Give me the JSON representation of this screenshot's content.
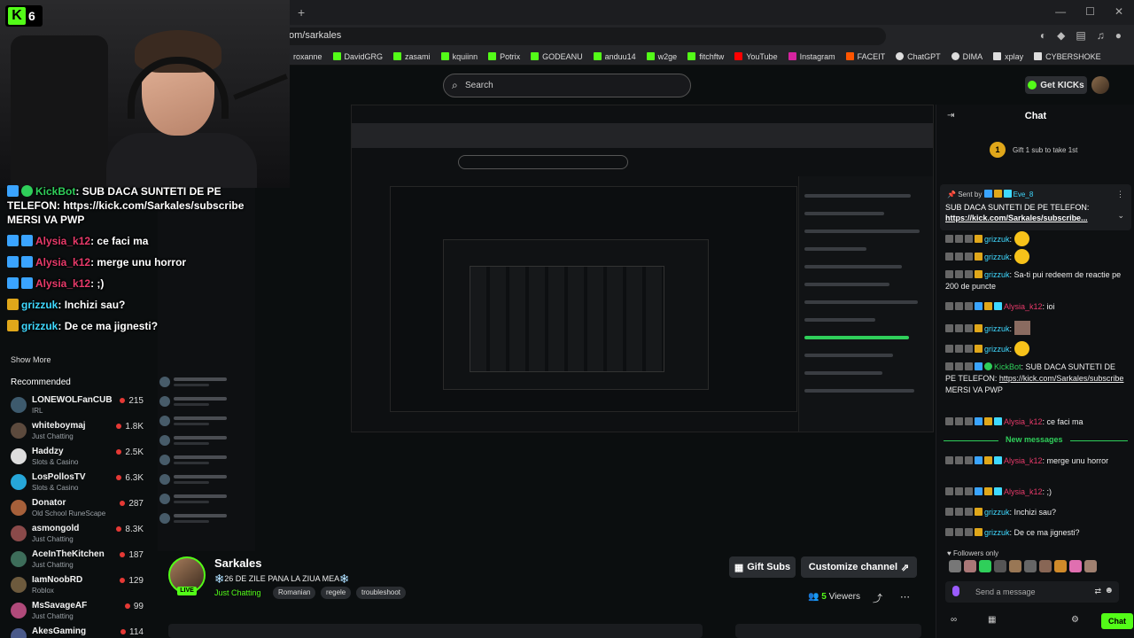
{
  "browser": {
    "url": "om/sarkales",
    "bookmarks": [
      "roxanne",
      "DavidGRG",
      "zasami",
      "kquiinn",
      "Potrix",
      "GODEANU",
      "anduu14",
      "w2ge",
      "fitchftw",
      "YouTube",
      "Instagram",
      "FACEIT",
      "ChatGPT",
      "DIMA",
      "xplay",
      "CYBERSHOKE"
    ]
  },
  "header": {
    "search_placeholder": "Search",
    "get_kicks": "Get KICKs"
  },
  "overlay": {
    "badge_count": "6",
    "chat": [
      {
        "user": "KickBot",
        "text": "SUB DACA SUNTETI DE PE"
      },
      {
        "user": "",
        "text": "TELEFON: https://kick.com/Sarkales/subscribe"
      },
      {
        "user": "",
        "text": "MERSI VA PWP"
      },
      {
        "user": "Alysia_k12",
        "text": "ce faci ma"
      },
      {
        "user": "Alysia_k12",
        "text": "merge unu horror"
      },
      {
        "user": "Alysia_k12",
        "text": ";)"
      },
      {
        "user": "grizzuk",
        "text": "Inchizi sau?"
      },
      {
        "user": "grizzuk",
        "text": "De ce ma jignesti?"
      }
    ]
  },
  "sidebar": {
    "show_more": "Show More",
    "recommended_title": "Recommended",
    "recommended": [
      {
        "name": "LONEWOLFanCUB",
        "category": "IRL",
        "viewers": "215"
      },
      {
        "name": "whiteboymaj",
        "category": "Just Chatting",
        "viewers": "1.8K"
      },
      {
        "name": "Haddzy",
        "category": "Slots & Casino",
        "viewers": "2.5K"
      },
      {
        "name": "LosPollosTV",
        "category": "Slots & Casino",
        "viewers": "6.3K"
      },
      {
        "name": "Donator",
        "category": "Old School RuneScape",
        "viewers": "287"
      },
      {
        "name": "asmongold",
        "category": "Just Chatting",
        "viewers": "8.3K"
      },
      {
        "name": "AceInTheKitchen",
        "category": "Just Chatting",
        "viewers": "187"
      },
      {
        "name": "IamNoobRD",
        "category": "Roblox",
        "viewers": "129"
      },
      {
        "name": "MsSavageAF",
        "category": "Just Chatting",
        "viewers": "99"
      },
      {
        "name": "AkesGaming",
        "category": "",
        "viewers": "114"
      }
    ]
  },
  "stream": {
    "streamer": "Sarkales",
    "live": "LIVE",
    "title": "❄️26 DE ZILE PANA LA ZIUA MEA❄️",
    "category": "Just Chatting",
    "tags": [
      "Romanian",
      "regele",
      "troubleshoot"
    ],
    "gift_subs": "Gift Subs",
    "customize": "Customize channel",
    "viewers_count": "5",
    "viewers_label": "Viewers"
  },
  "chat": {
    "title": "Chat",
    "gift_prompt": "Gift 1 sub to take 1st",
    "gift_count": "1",
    "pinned": {
      "sent_by": "Sent by",
      "user": "Eve_8",
      "text": "SUB DACA SUNTETI DE PE TELEFON:",
      "link": "https://kick.com/Sarkales/subscribe..."
    },
    "messages": [
      {
        "user": "grizzuk",
        "text": ":"
      },
      {
        "user": "grizzuk",
        "text": ":"
      },
      {
        "user": "grizzuk",
        "text": "Sa-ti pui redeem de reactie pe 200 de puncte"
      },
      {
        "user": "Alysia_k12",
        "text": "ioi"
      },
      {
        "user": "grizzuk",
        "text": ":"
      },
      {
        "user": "grizzuk",
        "text": ":"
      },
      {
        "user": "KickBot",
        "text": "SUB DACA SUNTETI DE PE TELEFON:",
        "link": "https://kick.com/Sarkales/subscribe",
        "after": "MERSI VA PWP"
      },
      {
        "user": "Alysia_k12",
        "text": "ce faci ma"
      },
      {
        "user": "Alysia_k12",
        "text": "merge unu horror"
      },
      {
        "user": "Alysia_k12",
        "text": ";)"
      },
      {
        "user": "grizzuk",
        "text": "Inchizi sau?"
      },
      {
        "user": "grizzuk",
        "text": "De ce ma jignesti?"
      }
    ],
    "new_messages": "New messages",
    "followers_only": "Followers only",
    "send_placeholder": "Send a message",
    "chat_button": "Chat"
  }
}
